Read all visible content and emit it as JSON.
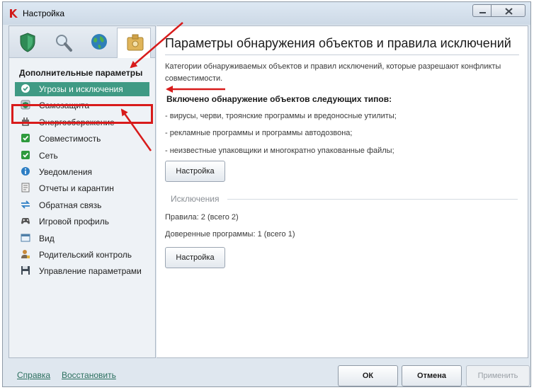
{
  "window": {
    "title": "Настройка",
    "app_icon": "kaspersky-k-icon",
    "controls": [
      "minimize-icon",
      "close-icon"
    ]
  },
  "tabs": [
    {
      "icon": "shield-icon",
      "active": false
    },
    {
      "icon": "magnifier-icon",
      "active": false
    },
    {
      "icon": "globe-icon",
      "active": false
    },
    {
      "icon": "settings-box-icon",
      "active": true
    }
  ],
  "sidebar": {
    "section_title": "Дополнительные параметры",
    "items": [
      {
        "label": "Угрозы и исключения",
        "icon": "check-icon",
        "selected": true
      },
      {
        "label": "Самозащита",
        "icon": "self-defense-icon"
      },
      {
        "label": "Энергосбережение",
        "icon": "power-icon"
      },
      {
        "label": "Совместимость",
        "icon": "compatibility-icon"
      },
      {
        "label": "Сеть",
        "icon": "network-icon"
      },
      {
        "label": "Уведомления",
        "icon": "info-icon"
      },
      {
        "label": "Отчеты и карантин",
        "icon": "report-icon"
      },
      {
        "label": "Обратная связь",
        "icon": "feedback-arrows-icon"
      },
      {
        "label": "Игровой профиль",
        "icon": "gamepad-icon"
      },
      {
        "label": "Вид",
        "icon": "window-view-icon"
      },
      {
        "label": "Родительский контроль",
        "icon": "parental-control-icon"
      },
      {
        "label": "Управление параметрами",
        "icon": "floppy-disk-icon"
      }
    ]
  },
  "main": {
    "title": "Параметры обнаружения объектов и правила исключений",
    "description": "Категории обнаруживаемых объектов и правил исключений, которые разрешают конфликты совместимости.",
    "detection_heading": "Включено обнаружение объектов следующих типов:",
    "detection_items": [
      "- вирусы, черви, троянские программы и вредоносные утилиты;",
      "- рекламные программы и программы автодозвона;",
      "- неизвестные упаковщики и многократно упакованные файлы;"
    ],
    "settings_button": "Настройка",
    "exclusions_label": "Исключения",
    "rules_text": "Правила: 2 (всего 2)",
    "trusted_text": "Доверенные программы: 1 (всего 1)",
    "settings_button_2": "Настройка"
  },
  "footer": {
    "help_link": "Справка",
    "restore_link": "Восстановить",
    "ok": "ОК",
    "cancel": "Отмена",
    "apply": "Применить"
  },
  "colors": {
    "selected_item": "#3f9a84",
    "annotation_red": "#d81b1b",
    "link": "#2b6f5e"
  }
}
